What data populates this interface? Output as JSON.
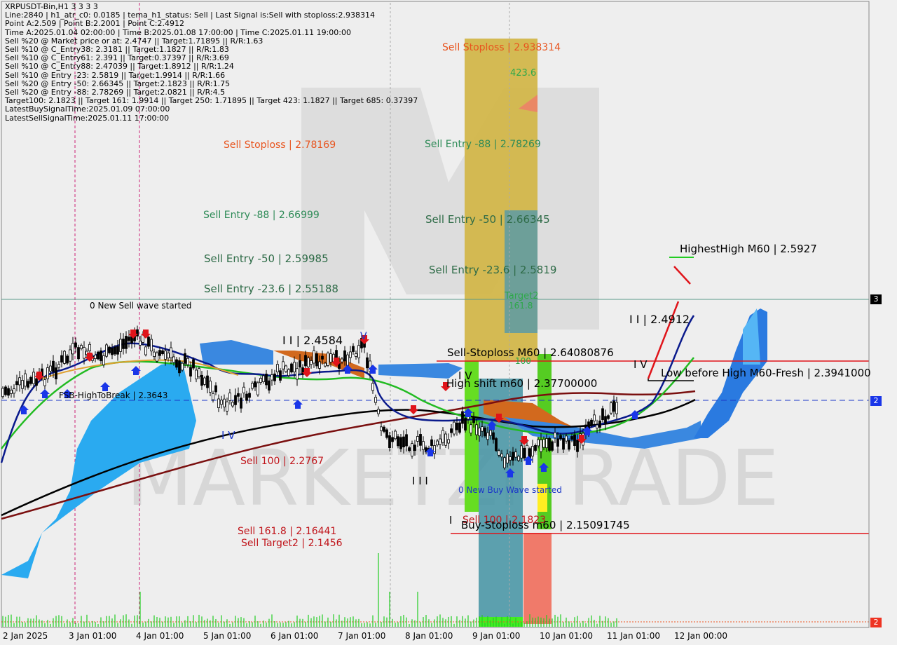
{
  "header": {
    "lines": [
      "XRPUSDT-Bin,H1  3 3 3 3",
      "Line:2840 | h1_atr_c0: 0.0185 | tema_h1_status: Sell | Last Signal is:Sell with stoploss:2.938314",
      "Point A:2.509 | Point B:2.2001 | Point C:2.4912",
      "Time A:2025.01.04 02:00:00 | Time B:2025.01.08 17:00:00 | Time C:2025.01.11 19:00:00",
      "Sell %20 @ Market price or at: 2.4747 || Target:1.71895 || R/R:1.63",
      "Sell %10 @ C_Entry38: 2.3181 || Target:1.1827 || R/R:1.83",
      "Sell %10 @ C_Entry61: 2.391 || Target:0.37397 || R/R:3.69",
      "Sell %10 @ C_Entry88: 2.47039 || Target:1.8912 || R/R:1.24",
      "Sell %10 @ Entry -23: 2.5819 || Target:1.9914 || R/R:1.66",
      "Sell %20 @ Entry -50: 2.66345 || Target:2.1823 || R/R:1.75",
      "Sell %20 @ Entry -88: 2.78269 || Target:2.0821 || R/R:4.5",
      "Target100: 2.1823 || Target 161: 1.9914 || Target 250: 1.71895 || Target 423: 1.1827 || Target 685: 0.37397",
      "LatestBuySignalTime:2025.01.09 07:00:00",
      "LatestSellSignalTime:2025.01.11 17:00:00"
    ]
  },
  "watermark": "MARKETZITRADE",
  "colors": {
    "background": "#f0f0f0",
    "up_candle": "#000000",
    "sell_label": "#e8541e",
    "entry_label": "#2e8b57",
    "sell_target_label": "#c0141a",
    "stop_line": "#e0141a",
    "ema_blue": "#0a1a8c",
    "ema_green": "#22bb22",
    "ema_black": "#000000",
    "ema_maroon": "#7a0f0f",
    "cloud_blue": "#2aaaf0",
    "cloud_orange": "#d2691e"
  },
  "labels": {
    "sell_stoploss_top": "Sell Stoploss | 2.938314",
    "fib_423": "423.6",
    "sell_entry_88_right": "Sell Entry -88 | 2.78269",
    "sell_stoploss_left": "Sell Stoploss | 2.78169",
    "sell_entry_88_left": "Sell Entry -88 | 2.66999",
    "sell_entry_50_right": "Sell Entry -50 | 2.66345",
    "sell_entry_50_left": "Sell Entry -50 | 2.59985",
    "sell_entry_236_right": "Sell Entry -23.6 | 2.5819",
    "sell_entry_236_left": "Sell Entry -23.6 | 2.55188",
    "target2": "Target2",
    "fib_161": "161.8",
    "highest_high": "HighestHigh   M60 | 2.5927",
    "new_sell_wave": "0 New Sell wave started",
    "wave_ii": "I I | 2.4912",
    "wave_ii_left": "I I | 2.4584",
    "wave_v_top": "V",
    "sell_stoploss_m60": "Sell-Stoploss M60 | 2.64080876",
    "fib_100": "100",
    "wave_iv": "I V",
    "low_before_high": "Low before High   M60-Fresh | 2.3941000",
    "wave_iv_mid": "I V",
    "high_shift": "High shift m60 | 2.37700000",
    "fsb": "FSB-HighToBreak | 2.3643",
    "wave_iv_low": "I V",
    "sell_100_left": "Sell 100 | 2.2767",
    "wave_iii": "I I I",
    "new_buy_wave": "0 New Buy Wave started",
    "wave_i": "I",
    "sell_100_right": "Sell 100 | 2.1823",
    "buy_stoploss": "Buy-Stoploss m60 | 2.15091745",
    "sell_1618": "Sell 161.8 | 2.16441",
    "sell_target2": "Sell Target2 | 2.1456"
  },
  "right_badges": [
    "3",
    "2",
    "2"
  ],
  "chart_data": {
    "type": "candlestick",
    "symbol": "XRPUSDT-Bin",
    "timeframe": "H1",
    "x_tick_labels": [
      "2 Jan 2025",
      "3 Jan 01:00",
      "4 Jan 01:00",
      "5 Jan 01:00",
      "6 Jan 01:00",
      "7 Jan 01:00",
      "8 Jan 01:00",
      "9 Jan 01:00",
      "10 Jan 01:00",
      "11 Jan 01:00",
      "12 Jan 00:00"
    ],
    "levels": [
      {
        "name": "Sell-Stoploss M60",
        "value": 2.64080876,
        "color": "#e0141a"
      },
      {
        "name": "Buy-Stoploss m60",
        "value": 2.15091745,
        "color": "#e0141a"
      }
    ],
    "grid": false
  }
}
